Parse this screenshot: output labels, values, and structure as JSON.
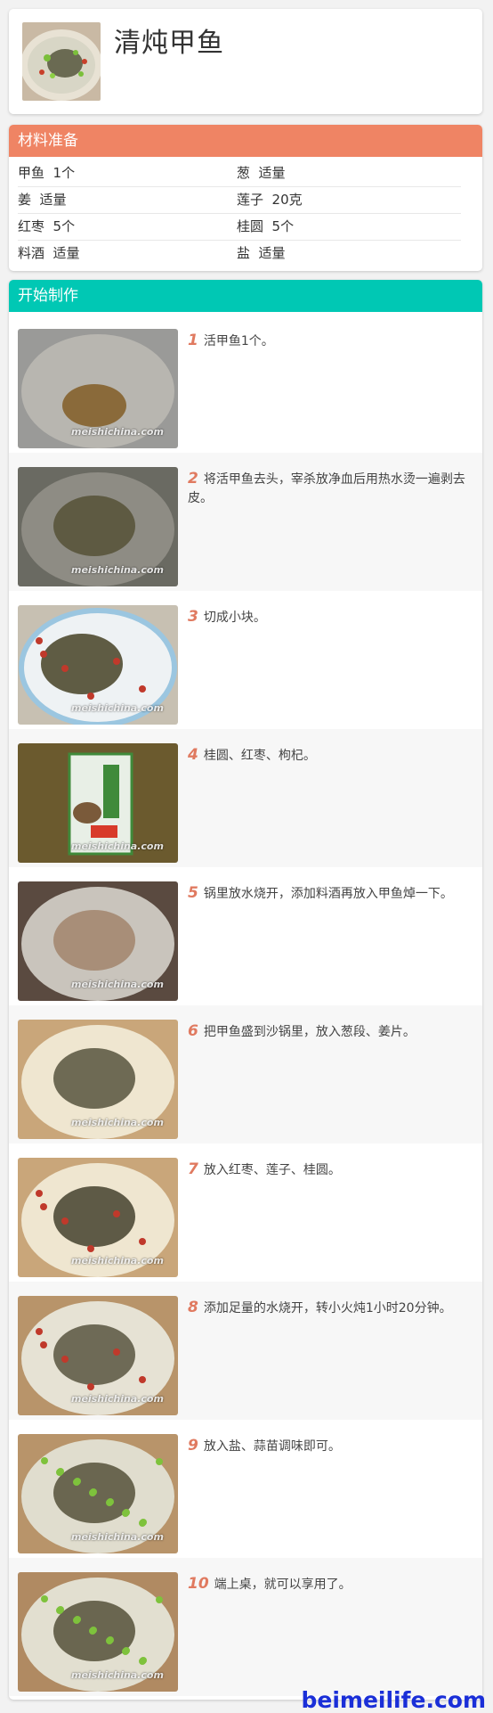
{
  "recipe": {
    "title": "清炖甲鱼",
    "thumb_icon": "soup-bowl-photo"
  },
  "colors": {
    "ingredients_header": "#ef8464",
    "steps_header": "#00c8b4",
    "step_number": "#e07a60",
    "site_watermark": "#1a2fd8"
  },
  "ingredients": {
    "heading": "材料准备",
    "rows": [
      [
        {
          "text": "甲鱼  1个"
        },
        {
          "text": "葱  适量"
        }
      ],
      [
        {
          "text": "姜  适量"
        },
        {
          "text": "莲子  20克"
        }
      ],
      [
        {
          "text": "红枣  5个"
        },
        {
          "text": "桂圆  5个"
        }
      ],
      [
        {
          "text": "料酒  适量"
        },
        {
          "text": "盐  适量"
        }
      ]
    ]
  },
  "steps": {
    "heading": "开始制作",
    "image_watermark": "meishichina.com",
    "items": [
      {
        "num": "1",
        "text": "活甲鱼1个。",
        "scene": "sink"
      },
      {
        "num": "2",
        "text": "将活甲鱼去头，宰杀放净血后用热水烫一遍剥去皮。",
        "scene": "basin"
      },
      {
        "num": "3",
        "text": "切成小块。",
        "scene": "plate"
      },
      {
        "num": "4",
        "text": "桂圆、红枣、枸杞。",
        "scene": "packet"
      },
      {
        "num": "5",
        "text": "锅里放水烧开，添加料酒再放入甲鱼焯一下。",
        "scene": "pot"
      },
      {
        "num": "6",
        "text": "把甲鱼盛到沙锅里，放入葱段、姜片。",
        "scene": "claypot"
      },
      {
        "num": "7",
        "text": "放入红枣、莲子、桂圆。",
        "scene": "claypot2"
      },
      {
        "num": "8",
        "text": "添加足量的水烧开，转小火炖1小时20分钟。",
        "scene": "broth"
      },
      {
        "num": "9",
        "text": "放入盐、蒜苗调味即可。",
        "scene": "garnish"
      },
      {
        "num": "10",
        "text": "端上桌，就可以享用了。",
        "scene": "served"
      }
    ]
  },
  "site_watermark": "beimeilife.com"
}
